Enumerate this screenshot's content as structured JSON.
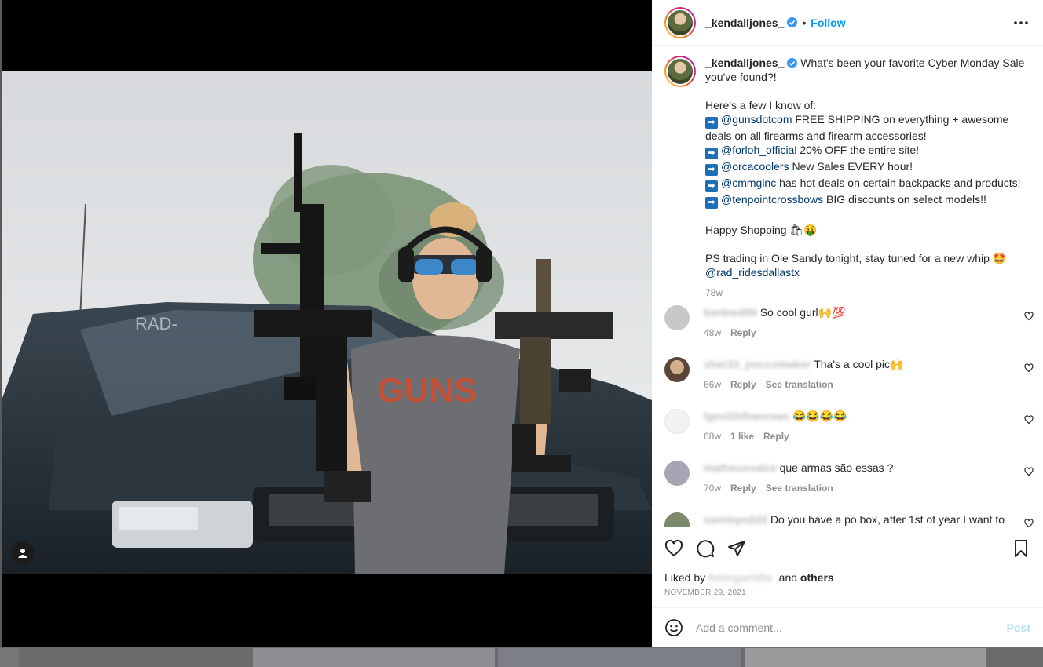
{
  "post": {
    "username": "_kendalljones_",
    "follow_label": "Follow",
    "dot": "•"
  },
  "caption": {
    "username": "_kendalljones_",
    "line1": "What's been your favorite Cyber Monday Sale you've found?!",
    "intro": "Here's a few I know of:",
    "arrow": "➡",
    "items": [
      {
        "mention": "@gunsdotcom",
        "text": " FREE SHIPPING on everything + awesome deals on all firearms and firearm accessories!"
      },
      {
        "mention": "@forloh_official",
        "text": " 20% OFF the entire site!"
      },
      {
        "mention": "@orcacoolers",
        "text": " New Sales EVERY hour!"
      },
      {
        "mention": "@cmmginc",
        "text": " has hot deals on certain backpacks and products!"
      },
      {
        "mention": "@tenpointcrossbows",
        "text": " BIG discounts on select models!!"
      }
    ],
    "shopping": "Happy Shopping 🛍🤑",
    "ps": "PS trading in Ole Sandy tonight, stay tuned for a new whip 🤩",
    "ps_mention": "@rad_ridesdallastx",
    "time": "78w"
  },
  "comments": [
    {
      "name": "bankwd89",
      "text": "So cool gurl🙌💯",
      "time": "48w",
      "likes": "",
      "reply": "Reply",
      "translate": "",
      "avatar_color": "#c8c8c8"
    },
    {
      "name": "sher33_jroccomaker",
      "text": "Tha's a cool pic🙌",
      "time": "66w",
      "likes": "",
      "reply": "Reply",
      "translate": "See translation",
      "avatar_color": "#6b5344"
    },
    {
      "name": "lgeo32dhanceas",
      "text": "😂😂😂😂",
      "time": "68w",
      "likes": "1 like",
      "reply": "Reply",
      "translate": "",
      "avatar_color": "#f0f0f0"
    },
    {
      "name": "matheusvalce",
      "text": "que armas são essas ?",
      "time": "70w",
      "likes": "",
      "reply": "Reply",
      "translate": "See translation",
      "avatar_color": "#a8a4b4"
    },
    {
      "name": "sammyo2d3",
      "text": "Do you have a po box, after 1st of year I want to",
      "time": "",
      "likes": "",
      "reply": "",
      "translate": "",
      "avatar_color": "#7a8a6a"
    }
  ],
  "likes": {
    "prefix": "Liked by",
    "name": "fishingwrld9e",
    "and": "and",
    "others": "others"
  },
  "date": "NOVEMBER 29, 2021",
  "add_comment": {
    "placeholder": "Add a comment...",
    "post_label": "Post"
  },
  "photo": {
    "windshield_text": "RAD-",
    "shirt_text": "GUNS"
  },
  "colors": {
    "link": "#0095f6",
    "mention": "#00376b",
    "muted": "#8e8e8e"
  }
}
